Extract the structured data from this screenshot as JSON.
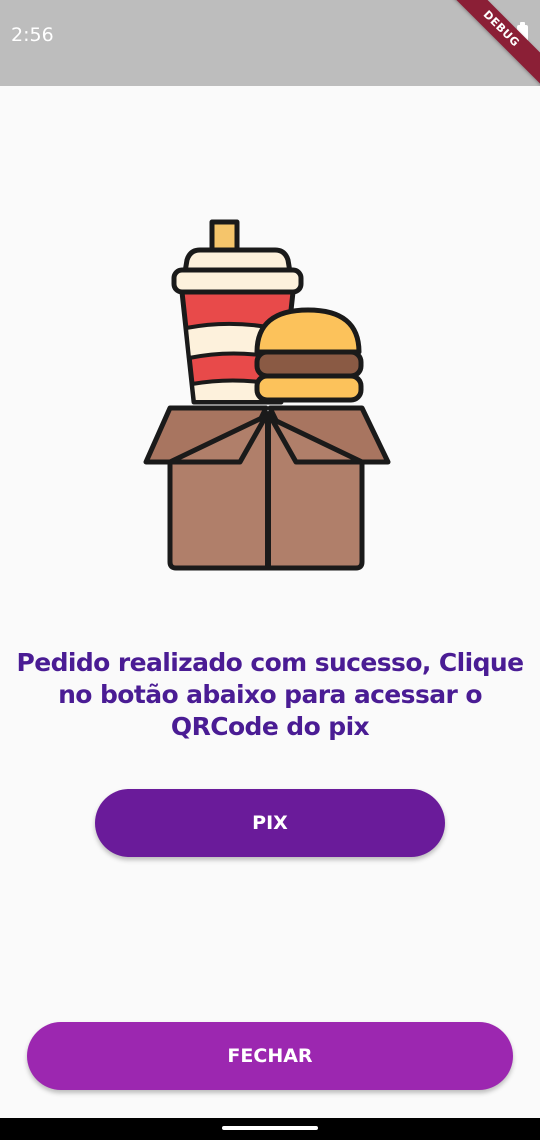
{
  "status_bar": {
    "time": "2:56",
    "debug_label": "DEBUG",
    "battery_icon": "battery-full-icon"
  },
  "illustration": {
    "icon": "food-delivery-box-icon"
  },
  "message": {
    "text": "Pedido realizado com sucesso, Clique no botão abaixo para acessar o QRCode do pix"
  },
  "buttons": {
    "pix_label": "PIX",
    "fechar_label": "FECHAR"
  },
  "colors": {
    "message": "#4a1c94",
    "pix_button": "#6a1b9a",
    "fechar_button": "#9c27b0",
    "status_bar": "#bdbdbd",
    "debug_banner": "#8b1f36"
  }
}
